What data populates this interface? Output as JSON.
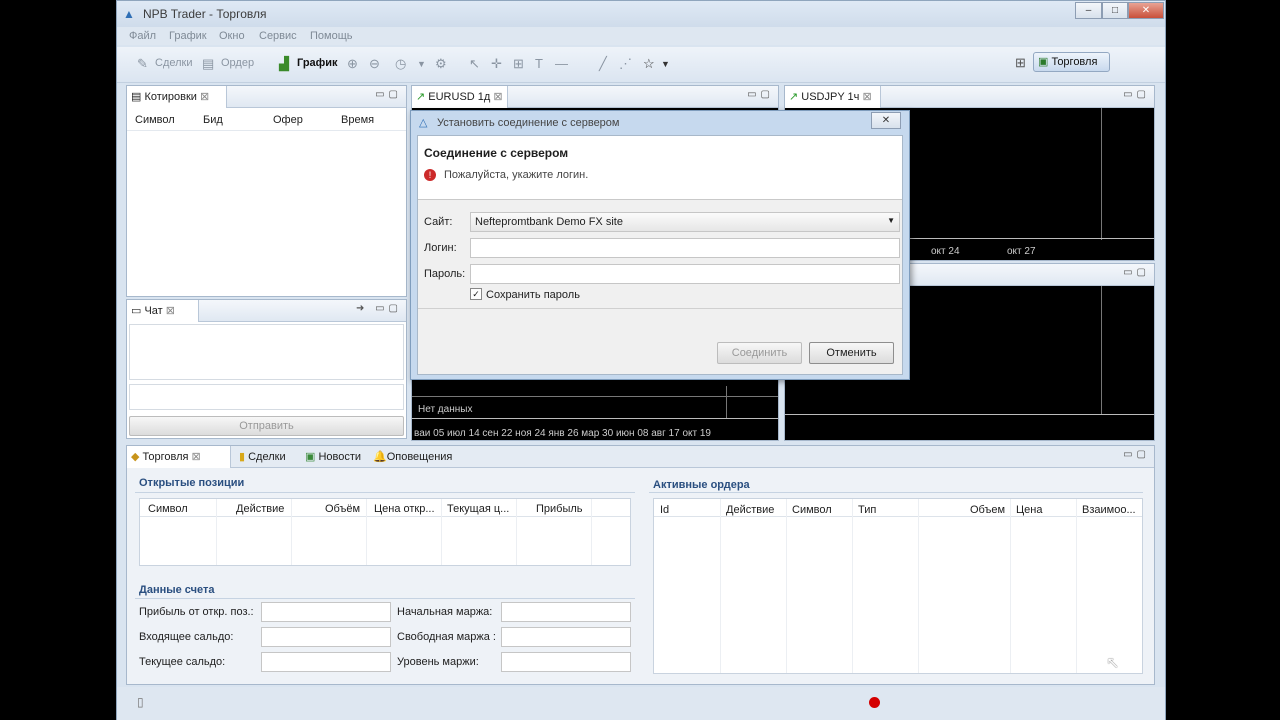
{
  "window": {
    "title": "NPB Trader - Торговля",
    "controls": [
      "–",
      "□",
      "✕"
    ]
  },
  "menu": [
    "Файл",
    "График",
    "Окно",
    "Сервис",
    "Помощь"
  ],
  "toolbar": {
    "deals": "Сделки",
    "order": "Ордер",
    "chart": "График",
    "perspective": "Торговля"
  },
  "quotes": {
    "tab": "Котировки",
    "columns": [
      "Символ",
      "Бид",
      "Офер",
      "Время"
    ]
  },
  "chat": {
    "tab": "Чат",
    "send": "Отправить"
  },
  "charts": {
    "eurusd_tab": "EURUSD 1д",
    "usdjpy_tab": "USDJPY 1ч",
    "usdjpy_axis": [
      "окт 24",
      "окт 27"
    ],
    "eurusd_nodata": "Нет данных",
    "eurusd_axis": "ваи 05 июл 14 сен 22 ноя 24 янв 26 мар 30 июн 08 авг 17 окт 19"
  },
  "dialog": {
    "title": "Установить соединение с сервером",
    "heading": "Соединение с сервером",
    "message": "Пожалуйста, укажите логин.",
    "site_label": "Сайт:",
    "site_value": "Neftepromtbank Demo FX site",
    "login_label": "Логин:",
    "password_label": "Пароль:",
    "save_password": "Сохранить пароль",
    "connect": "Соединить",
    "cancel": "Отменить"
  },
  "bottom_tabs": [
    "Торговля",
    "Сделки",
    "Новости",
    "Оповещения"
  ],
  "open_positions": {
    "title": "Открытые позиции",
    "columns": [
      "Символ",
      "Действие",
      "Объём",
      "Цена откр...",
      "Текущая ц...",
      "Прибыль"
    ]
  },
  "account": {
    "title": "Данные счета",
    "left": [
      "Прибыль от откр. поз.:",
      "Входящее сальдо:",
      "Текущее сальдо:"
    ],
    "right": [
      "Начальная маржа:",
      "Свободная маржа :",
      "Уровень маржи:"
    ]
  },
  "active_orders": {
    "title": "Активные ордера",
    "columns": [
      "Id",
      "Действие",
      "Символ",
      "Тип",
      "Объем",
      "Цена",
      "Взаимоо..."
    ]
  }
}
